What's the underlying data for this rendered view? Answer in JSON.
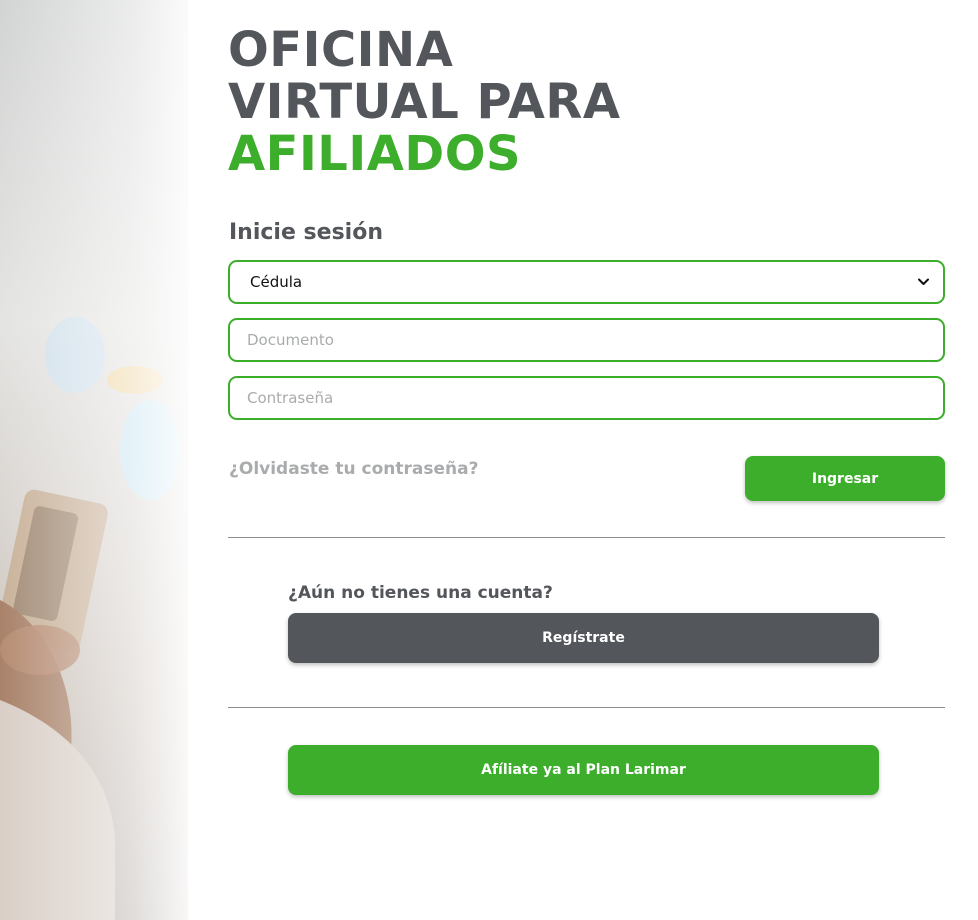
{
  "header": {
    "title_line1": "OFICINA",
    "title_line2": "VIRTUAL PARA",
    "title_line3": "AFILIADOS"
  },
  "login": {
    "heading": "Inicie sesión",
    "document_type": {
      "selected": "Cédula"
    },
    "document_input": {
      "placeholder": "Documento",
      "value": ""
    },
    "password_input": {
      "placeholder": "Contraseña",
      "value": ""
    },
    "forgot_password_label": "¿Olvidaste tu contraseña?",
    "submit_label": "Ingresar"
  },
  "register": {
    "prompt": "¿Aún no tienes una cuenta?",
    "button_label": "Regístrate"
  },
  "affiliate": {
    "button_label": "Afíliate ya al Plan Larimar"
  },
  "colors": {
    "brand_green": "#3dae2b",
    "brand_gray": "#53565a",
    "muted_text": "#a9abad"
  },
  "icons": {
    "select_caret": "chevron-down-icon"
  }
}
